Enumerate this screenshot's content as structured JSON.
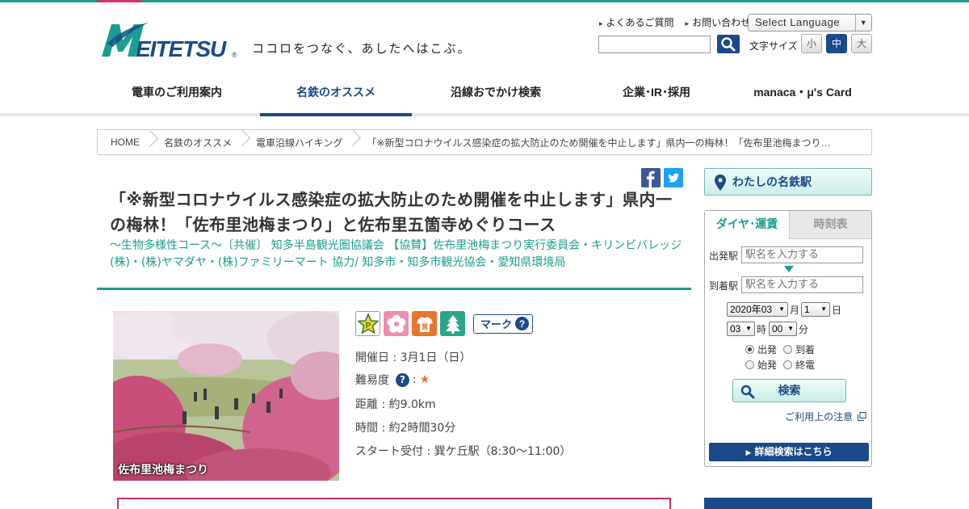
{
  "header": {
    "logo_text": "MEITETSU",
    "tagline": "ココロをつなぐ、あしたへはこぶ。",
    "links": [
      "よくあるご質問",
      "お問い合わせ"
    ],
    "language": "Select Language",
    "search_value": "",
    "font_size_label": "文字サイズ",
    "font_sizes": [
      "小",
      "中",
      "大"
    ],
    "font_size_active": "中"
  },
  "nav": {
    "items": [
      "電車のご利用案内",
      "名鉄のオススメ",
      "沿線おでかけ検索",
      "企業･IR･採用",
      "manaca・μ's Card"
    ],
    "active": "名鉄のオススメ"
  },
  "breadcrumb": [
    "HOME",
    "名鉄のオススメ",
    "電車沿線ハイキング",
    "「※新型コロナウイルス感染症の拡大防止のため開催を中止します」県内一の梅林！「佐布里池梅まつり…"
  ],
  "article": {
    "title": "「※新型コロナウイルス感染症の拡大防止のため開催を中止します」県内一の梅林！「佐布里池梅まつり」と佐布里五箇寺めぐりコース",
    "subtitle": "～生物多様性コース～〔共催〕 知多半島観光圏協議会 【協賛】佐布里池梅まつり実行委員会・キリンビバレッジ(株)・(株)ヤマダヤ・(株)ファミリーマート 協力/ 知多市・知多市観光協会・愛知県環境局",
    "photo_caption": "佐布里池梅まつり",
    "mark_button": "マーク",
    "mark_icons": [
      "parking-icon",
      "flower-icon",
      "gift-icon",
      "tree-icon"
    ],
    "date": "開催日 : 3月1日（日）",
    "difficulty_label": "難易度",
    "difficulty_sep": " :",
    "difficulty_stars": "★",
    "distance": "距離 : 約9.0km",
    "time": "時間 : 約2時間30分",
    "start": "スタート受付 : 巽ケ丘駅（8:30～11:00）"
  },
  "sidebar": {
    "my_station": "わたしの名鉄駅",
    "tabs": [
      "ダイヤ･運賃",
      "時刻表"
    ],
    "from_label": "出発駅",
    "to_label": "到着駅",
    "station_placeholder": "駅名を入力する",
    "year_month": "2020年03",
    "month_unit": "月",
    "day": "1",
    "day_unit": "日",
    "hour": "03",
    "hour_unit": "時",
    "minute": "00",
    "minute_unit": "分",
    "radios": [
      "出発",
      "到着",
      "始発",
      "終電"
    ],
    "radio_selected": "出発",
    "search_button": "検索",
    "notice_link": "ご利用上の注意",
    "detail_button": "詳細検索はこちら"
  },
  "colors": {
    "teal": "#1a9e8f",
    "navy": "#1a4a8a",
    "pink": "#d6336c"
  }
}
